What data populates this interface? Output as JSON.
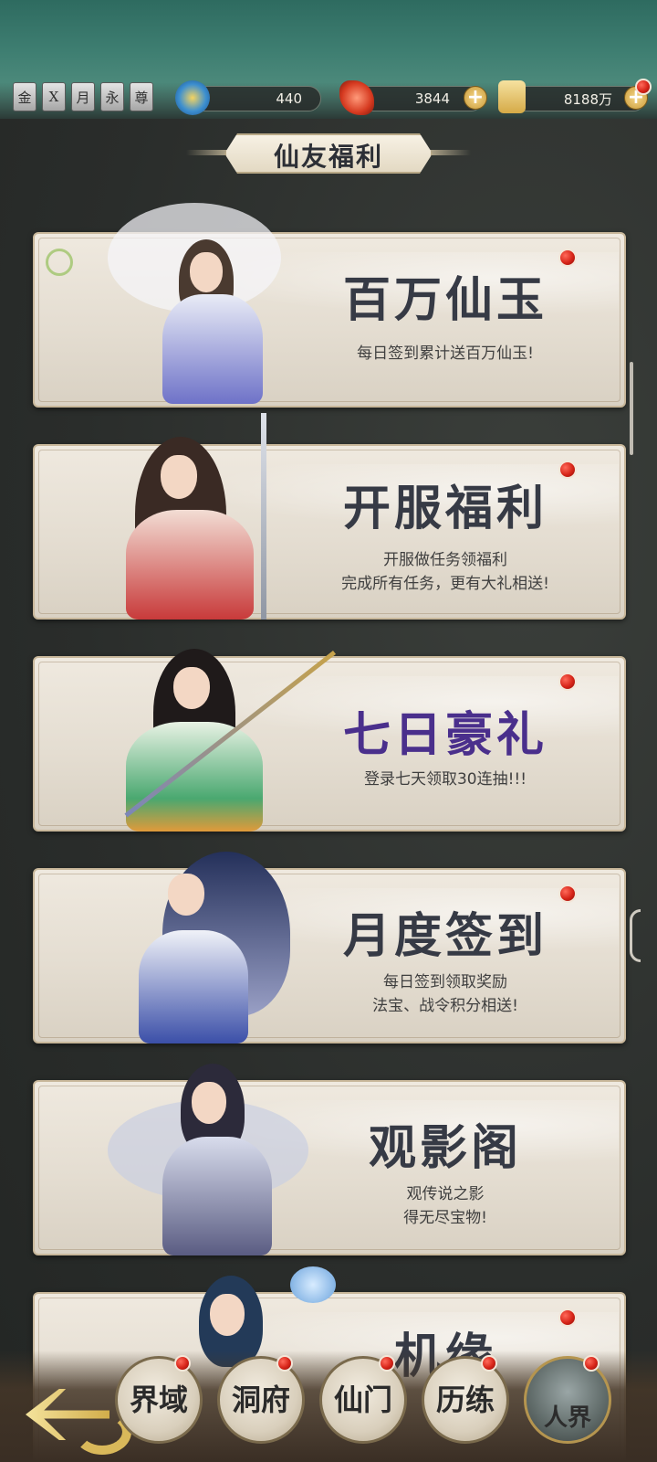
{
  "ranks": [
    "金",
    "X",
    "月",
    "永",
    "尊"
  ],
  "resources": {
    "spirit": "440",
    "jade": "3844",
    "gold": "8188万"
  },
  "header": {
    "title": "仙友福利"
  },
  "cards": [
    {
      "title": "百万仙玉",
      "desc1": "每日签到累计送百万仙玉!",
      "desc2": ""
    },
    {
      "title": "开服福利",
      "desc1": "开服做任务领福利",
      "desc2": "完成所有任务，更有大礼相送!"
    },
    {
      "title": "七日豪礼",
      "desc1": "登录七天领取30连抽!!!",
      "desc2": ""
    },
    {
      "title": "月度签到",
      "desc1": "每日签到领取奖励",
      "desc2": "法宝、战令积分相送!"
    },
    {
      "title": "观影阁",
      "desc1": "观传说之影",
      "desc2": "得无尽宝物!"
    },
    {
      "title": "机缘",
      "desc1": "",
      "desc2": ""
    }
  ],
  "nav": {
    "items": [
      "界域",
      "洞府",
      "仙门",
      "历练"
    ],
    "human": "人界"
  },
  "colors": {
    "accent_gold": "#d2ad4a",
    "badge_red": "#d62418",
    "title_ink": "#363a45",
    "title_purple": "#5a3aa0"
  },
  "icons": {
    "back": "back-arrow-icon",
    "plus": "plus-icon",
    "spirit": "spirit-swirl-icon",
    "jade": "jade-crystal-icon",
    "gold": "gold-ticket-icon"
  }
}
